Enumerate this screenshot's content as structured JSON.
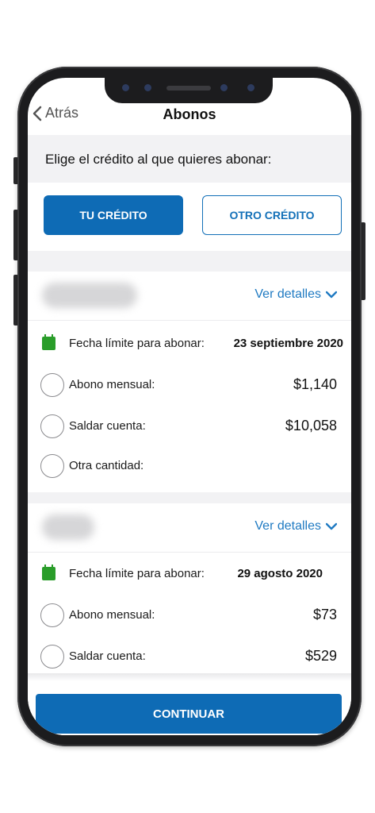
{
  "header": {
    "back_label": "Atrás",
    "title": "Abonos"
  },
  "prompt": "Elige el crédito al que quieres abonar:",
  "tabs": [
    {
      "label": "TU CRÉDITO",
      "active": true
    },
    {
      "label": "OTRO CRÉDITO",
      "active": false
    }
  ],
  "cards": [
    {
      "details_label": "Ver detalles",
      "deadline_label": "Fecha límite para abonar:",
      "deadline_value": "23 septiembre 2020",
      "options": [
        {
          "label": "Abono mensual:",
          "amount": "$1,140"
        },
        {
          "label": "Saldar cuenta:",
          "amount": "$10,058"
        },
        {
          "label": "Otra cantidad:",
          "amount": ""
        }
      ]
    },
    {
      "details_label": "Ver detalles",
      "deadline_label": "Fecha límite para abonar:",
      "deadline_value": "29 agosto 2020",
      "options": [
        {
          "label": "Abono mensual:",
          "amount": "$73"
        },
        {
          "label": "Saldar cuenta:",
          "amount": "$529"
        }
      ]
    }
  ],
  "continue_label": "CONTINUAR",
  "colors": {
    "primary": "#0e6bb5",
    "link": "#1f7ac2",
    "calendar": "#2a9d2a",
    "band": "#f2f2f4"
  }
}
